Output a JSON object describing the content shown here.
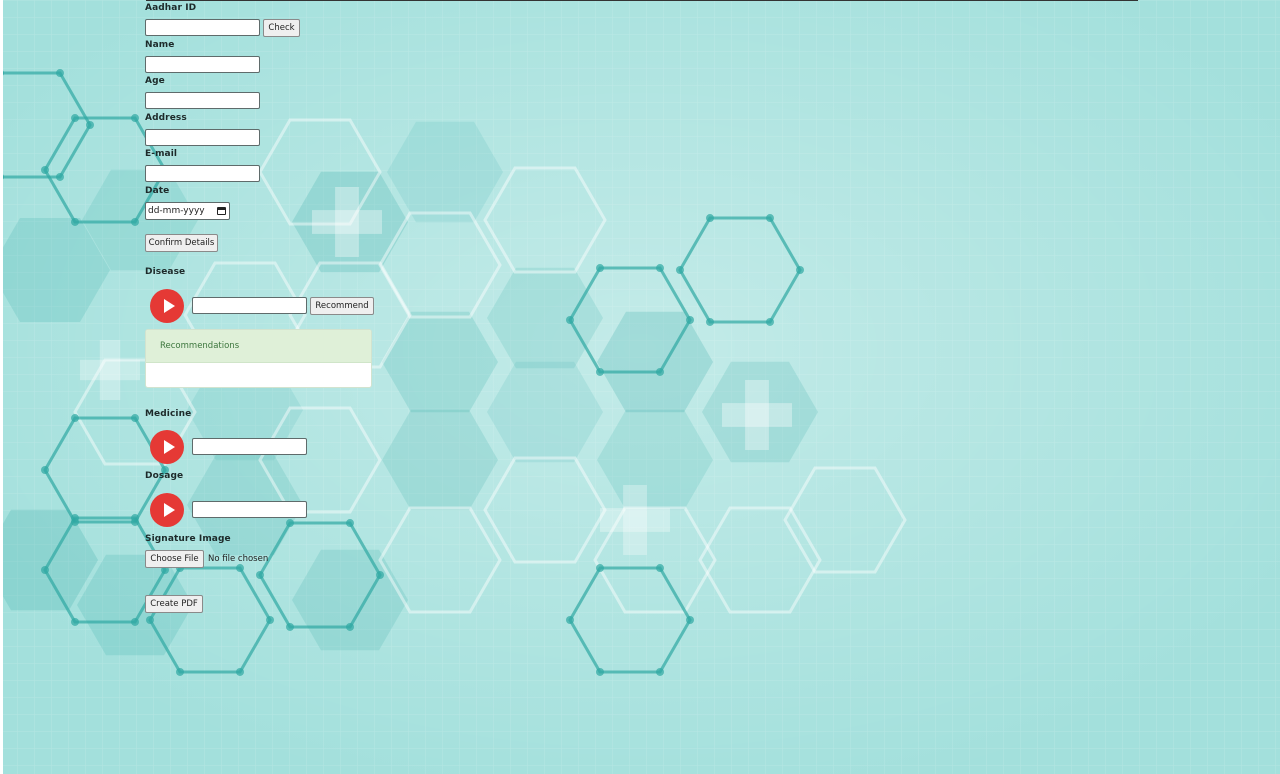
{
  "colors": {
    "accent_red": "#e53935",
    "panel_header": "#dff0d8",
    "background": "#a6e2de"
  },
  "form": {
    "aadhar_label": "Aadhar ID",
    "aadhar_value": "",
    "check_label": "Check",
    "name_label": "Name",
    "name_value": "",
    "age_label": "Age",
    "age_value": "",
    "address_label": "Address",
    "address_value": "",
    "email_label": "E-mail",
    "email_value": "",
    "date_label": "Date",
    "date_placeholder": "dd-mm-yyyy",
    "confirm_label": "Confirm Details",
    "disease_label": "Disease",
    "disease_value": "",
    "recommend_label": "Recommend",
    "recommendations_title": "Recommendations",
    "medicine_label": "Medicine",
    "medicine_value": "",
    "dosage_label": "Dosage",
    "dosage_value": "",
    "signature_label": "Signature Image",
    "choose_file_label": "Choose File",
    "file_status": "No file chosen",
    "create_pdf_label": "Create PDF"
  },
  "icons": {
    "play": "play-icon",
    "calendar": "calendar-icon"
  }
}
